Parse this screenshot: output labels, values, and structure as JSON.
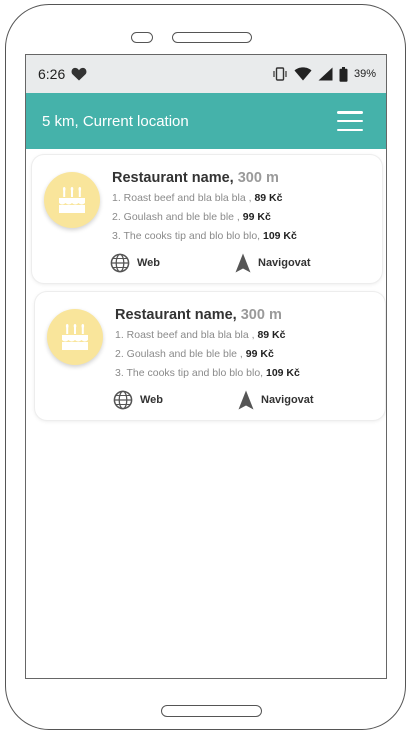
{
  "status_bar": {
    "time": "6:26",
    "battery_percent": "39%",
    "icons": [
      "heart-icon",
      "vibrate-icon",
      "wifi-icon",
      "signal-icon",
      "battery-icon"
    ]
  },
  "app_bar": {
    "title": "5 km, Current location",
    "menu_icon": "hamburger-menu-icon",
    "color": "#45b2aa"
  },
  "restaurants": [
    {
      "name": "Restaurant name,",
      "distance": "300 m",
      "icon": "cake-icon",
      "menu": [
        {
          "text": "1. Roast beef and bla bla bla , ",
          "price": "89 Kč"
        },
        {
          "text": "2.  Goulash and ble ble ble ,  ",
          "price": "99 Kč"
        },
        {
          "text": "3. The cooks tip and blo blo blo, ",
          "price": "109 Kč"
        }
      ],
      "actions": {
        "web": "Web",
        "navigate": "Navigovat"
      }
    },
    {
      "name": "Restaurant name,",
      "distance": "300 m",
      "icon": "cake-icon",
      "menu": [
        {
          "text": "1. Roast beef and bla bla bla , ",
          "price": "89 Kč"
        },
        {
          "text": "2.  Goulash and ble ble ble ,  ",
          "price": "99 Kč"
        },
        {
          "text": "3. The cooks tip and blo blo blo, ",
          "price": "109 Kč"
        }
      ],
      "actions": {
        "web": "Web",
        "navigate": "Navigovat"
      }
    }
  ],
  "colors": {
    "accent": "#45b2aa",
    "avatar": "#f9e59b",
    "status_bar": "#e9ebec"
  }
}
